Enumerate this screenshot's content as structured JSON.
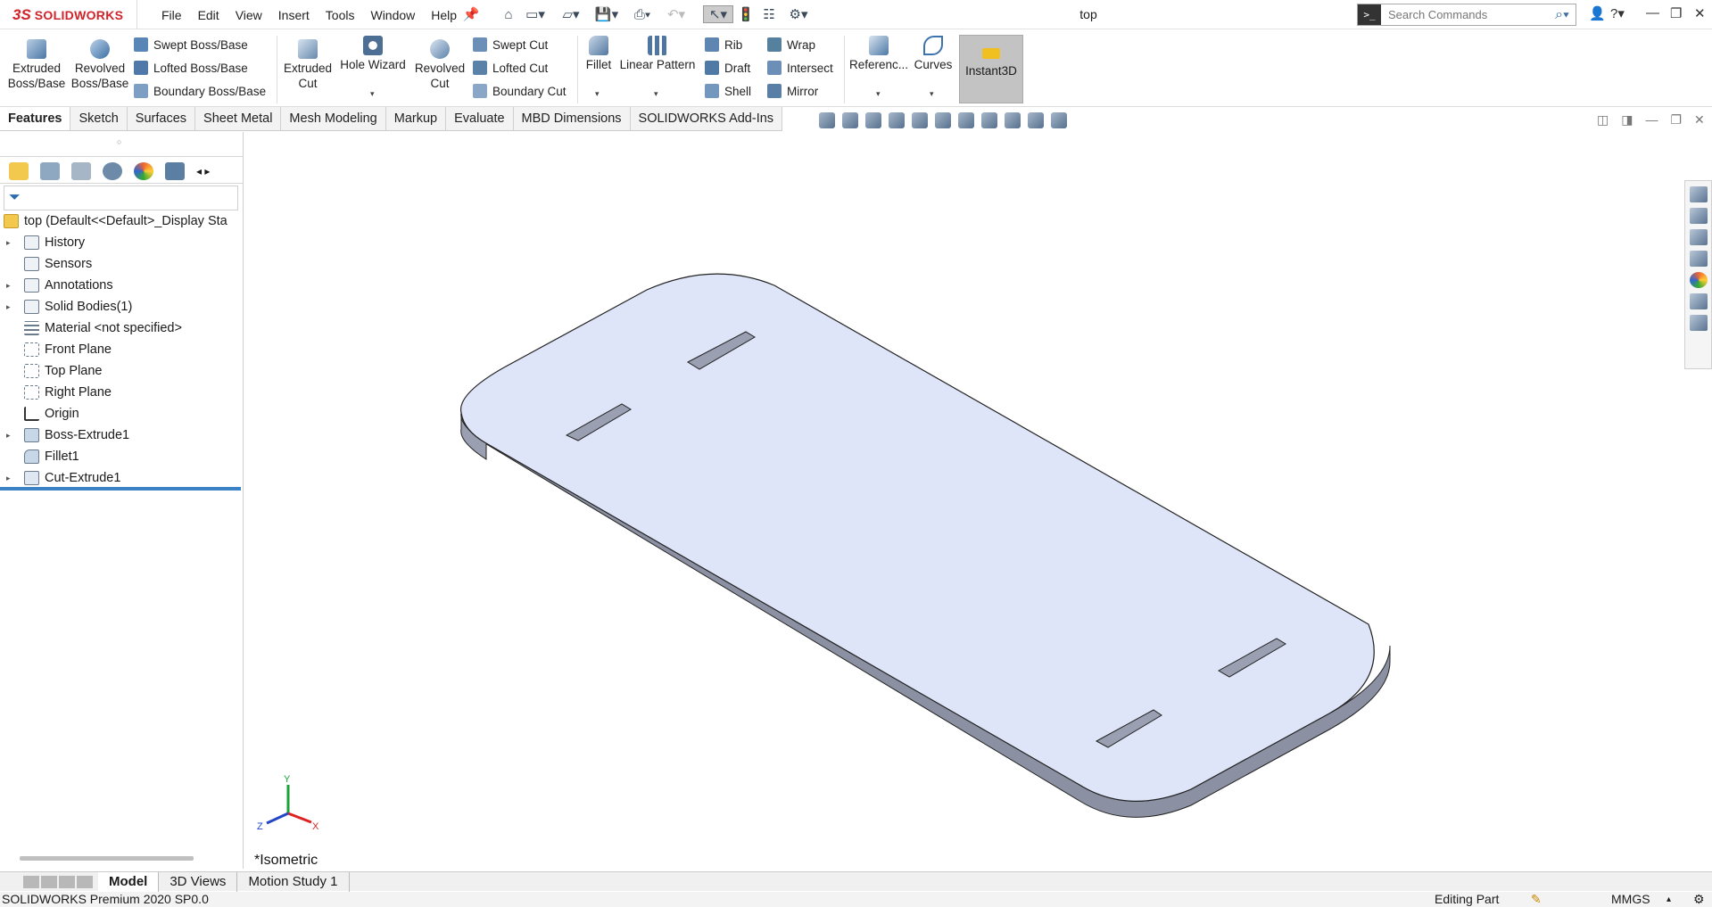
{
  "app": {
    "brand_ds": "3S",
    "brand_name": "SOLIDWORKS",
    "doc_title": "top"
  },
  "menu": [
    "File",
    "Edit",
    "View",
    "Insert",
    "Tools",
    "Window",
    "Help"
  ],
  "search": {
    "placeholder": "Search Commands"
  },
  "command_manager": {
    "extruded_boss": "Extruded Boss/Base",
    "revolved_boss": "Revolved Boss/Base",
    "swept_boss": "Swept Boss/Base",
    "lofted_boss": "Lofted Boss/Base",
    "boundary_boss": "Boundary Boss/Base",
    "extruded_cut": "Extruded Cut",
    "hole_wizard": "Hole Wizard",
    "revolved_cut": "Revolved Cut",
    "swept_cut": "Swept Cut",
    "lofted_cut": "Lofted Cut",
    "boundary_cut": "Boundary Cut",
    "fillet": "Fillet",
    "linear_pattern": "Linear Pattern",
    "rib": "Rib",
    "draft": "Draft",
    "shell": "Shell",
    "wrap": "Wrap",
    "intersect": "Intersect",
    "mirror": "Mirror",
    "reference": "Referenc...",
    "curves": "Curves",
    "instant3d": "Instant3D"
  },
  "tabs": [
    "Features",
    "Sketch",
    "Surfaces",
    "Sheet Metal",
    "Mesh Modeling",
    "Markup",
    "Evaluate",
    "MBD Dimensions",
    "SOLIDWORKS Add-Ins"
  ],
  "tree": {
    "root": "top  (Default<<Default>_Display Sta",
    "items": [
      "History",
      "Sensors",
      "Annotations",
      "Solid Bodies(1)",
      "Material <not specified>",
      "Front Plane",
      "Top Plane",
      "Right Plane",
      "Origin",
      "Boss-Extrude1",
      "Fillet1",
      "Cut-Extrude1"
    ]
  },
  "viewport": {
    "view_name": "*Isometric",
    "triad": {
      "x": "X",
      "y": "Y",
      "z": "Z"
    }
  },
  "bottom_tabs": [
    "Model",
    "3D Views",
    "Motion Study 1"
  ],
  "status": {
    "version": "SOLIDWORKS Premium 2020 SP0.0",
    "mode": "Editing Part",
    "units": "MMGS"
  },
  "colors": {
    "brand": "#d0232a",
    "model_face": "#dfe5f9",
    "model_side": "#8b91a3",
    "rollback": "#3b82c4"
  }
}
